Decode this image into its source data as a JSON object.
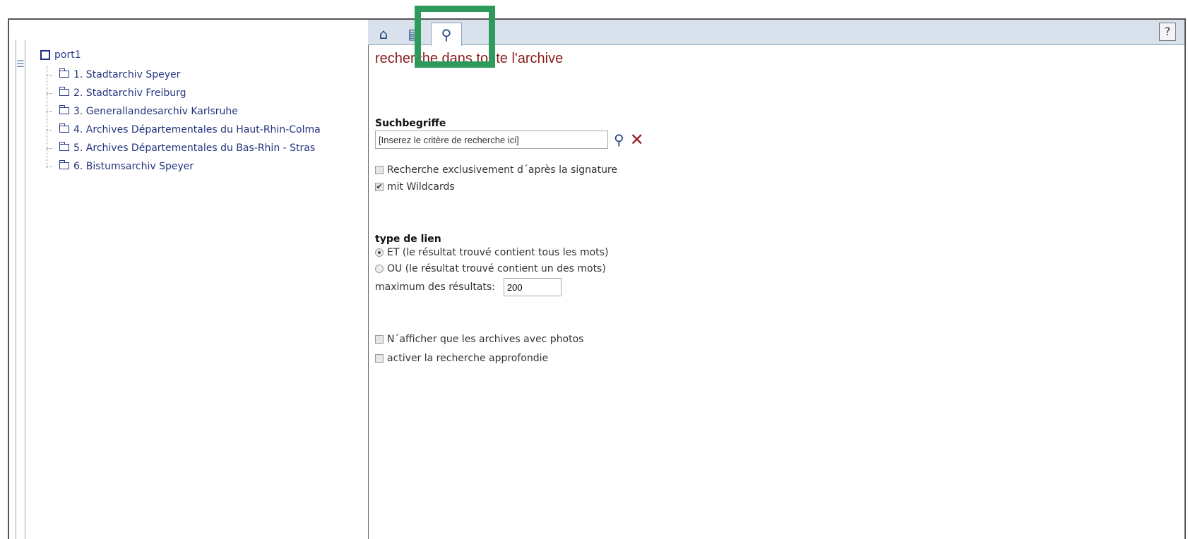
{
  "tree": {
    "root_label": "port1",
    "items": [
      {
        "label": "1. Stadtarchiv Speyer"
      },
      {
        "label": "2. Stadtarchiv Freiburg"
      },
      {
        "label": "3. Generallandesarchiv Karlsruhe"
      },
      {
        "label": "4. Archives Départementales du Haut-Rhin-Colma"
      },
      {
        "label": "5. Archives Départementales du Bas-Rhin - Stras"
      },
      {
        "label": "6. Bistumsarchiv Speyer"
      }
    ]
  },
  "tabs": [
    {
      "name": "home",
      "icon": "⌂",
      "active": false
    },
    {
      "name": "tree-view",
      "icon": "▤",
      "active": false
    },
    {
      "name": "search",
      "icon": "⚲",
      "active": true
    }
  ],
  "help_label": "?",
  "page_title": "recherche dans toute l'archive",
  "search": {
    "label": "Suchbegriffe",
    "placeholder": "[Inserez le critère de recherche ici]",
    "value": "[Inserez le critère de recherche ici]"
  },
  "options": {
    "signature_only": {
      "label": "Recherche exclusivement d´après la signature",
      "checked": false
    },
    "wildcards": {
      "label": "mit Wildcards",
      "checked": true
    }
  },
  "link_type": {
    "label": "type de lien",
    "and_label": "ET (le résultat trouvé contient tous les mots)",
    "or_label": "OU (le résultat trouvé contient un des mots)",
    "selected": "ET"
  },
  "max_results": {
    "label": "maximum des résultats:",
    "value": "200"
  },
  "extra": {
    "photos_only": {
      "label": "N´afficher que les archives avec photos",
      "checked": false
    },
    "advanced": {
      "label": "activer la recherche approfondie",
      "checked": false
    }
  },
  "colors": {
    "title": "#8a1c1c",
    "highlight": "#2e9b5c",
    "clear": "#9b1a1a",
    "tree_text": "#24347e"
  }
}
